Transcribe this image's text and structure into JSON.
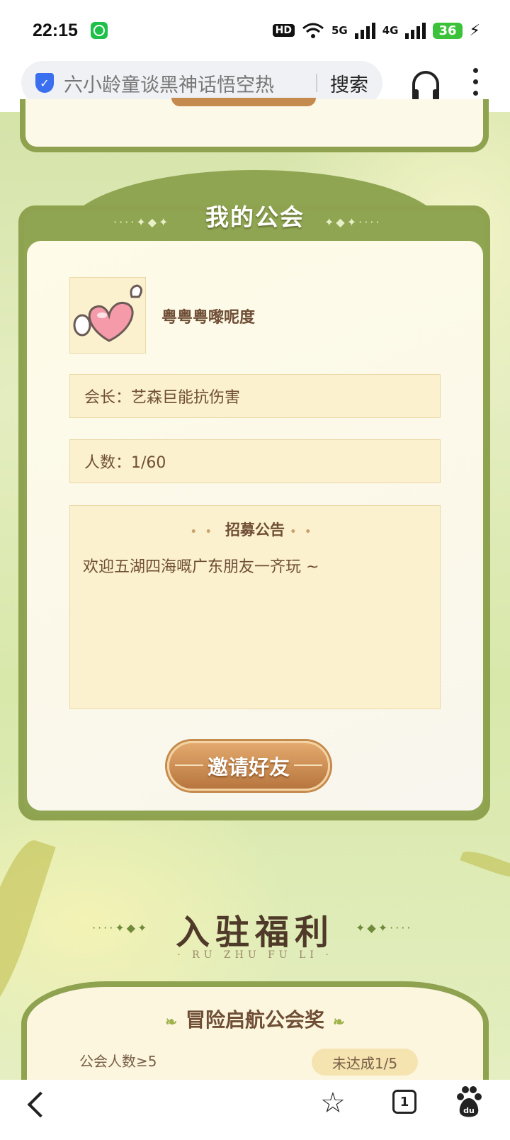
{
  "status_bar": {
    "time": "22:15",
    "hd_label": "HD",
    "net_5g": "5G",
    "net_4g": "4G",
    "battery": "36"
  },
  "browser": {
    "query": "六小龄童谈黑神话悟空热",
    "search_label": "搜索"
  },
  "guild": {
    "title": "我的公会",
    "name": "粤粤粤嚟呢度",
    "leader": "会长：艺森巨能抗伤害",
    "members": "人数：1/60",
    "notice_title": "招募公告",
    "notice_text": "欢迎五湖四海嘅广东朋友一齐玩 ~",
    "invite_label": "邀请好友"
  },
  "welfare": {
    "title": "入驻福利",
    "subtitle": "· RU ZHU FU LI ·",
    "reward_title": "冒险启航公会奖",
    "condition": "公会人数≥5",
    "progress_label": "未达成1/5"
  },
  "bottom_nav": {
    "tab_count": "1"
  },
  "colors": {
    "frame_green": "#8ea24f",
    "button_brown": "#c58a4d",
    "panel_cream": "#fbf1cf",
    "text_brown": "#6f4e35"
  }
}
